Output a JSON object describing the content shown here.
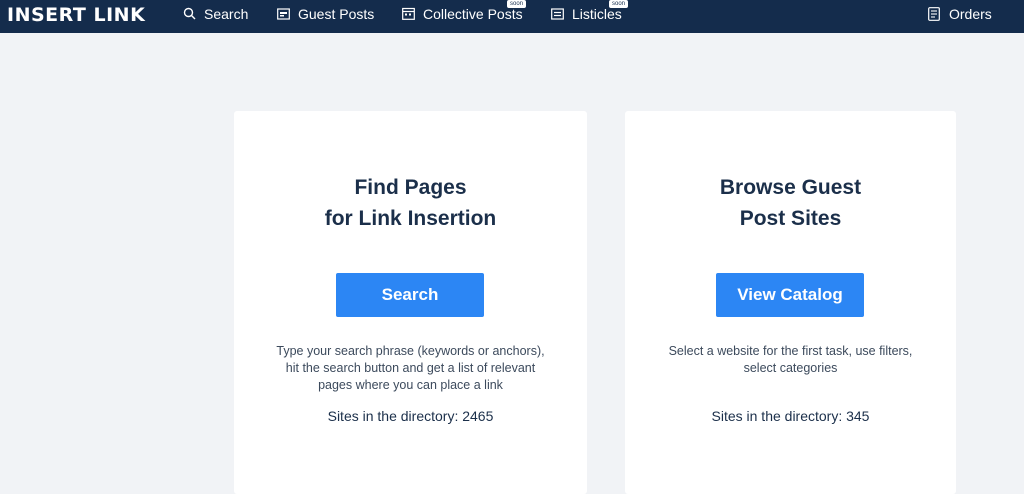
{
  "header": {
    "logo_text": "INSERT LINK",
    "nav": [
      {
        "label": "Search",
        "icon": "search-icon"
      },
      {
        "label": "Guest Posts",
        "icon": "image-icon"
      },
      {
        "label": "Collective Posts",
        "icon": "calendar-icon",
        "badge": "soon"
      },
      {
        "label": "Listicles",
        "icon": "list-icon",
        "badge": "soon"
      }
    ],
    "orders": {
      "label": "Orders",
      "icon": "document-icon"
    }
  },
  "cards": [
    {
      "title_lines": [
        "Find Pages",
        "for Link Insertion"
      ],
      "button_label": "Search",
      "description_lines": [
        "Type your search phrase (keywords or anchors),",
        "hit the search button and get a list of relevant",
        "pages where you can place a link"
      ],
      "count_text": "Sites in the directory: 2465"
    },
    {
      "title_lines": [
        "Browse Guest",
        "Post Sites"
      ],
      "button_label": "View Catalog",
      "description_lines": [
        "Select a website for the first task, use filters,",
        "select categories"
      ],
      "count_text": "Sites in the directory: 345"
    }
  ],
  "colors": {
    "header_bg": "#142c4c",
    "page_bg": "#f1f3f6",
    "accent": "#2c86f4",
    "title_text": "#1b2f4a"
  }
}
